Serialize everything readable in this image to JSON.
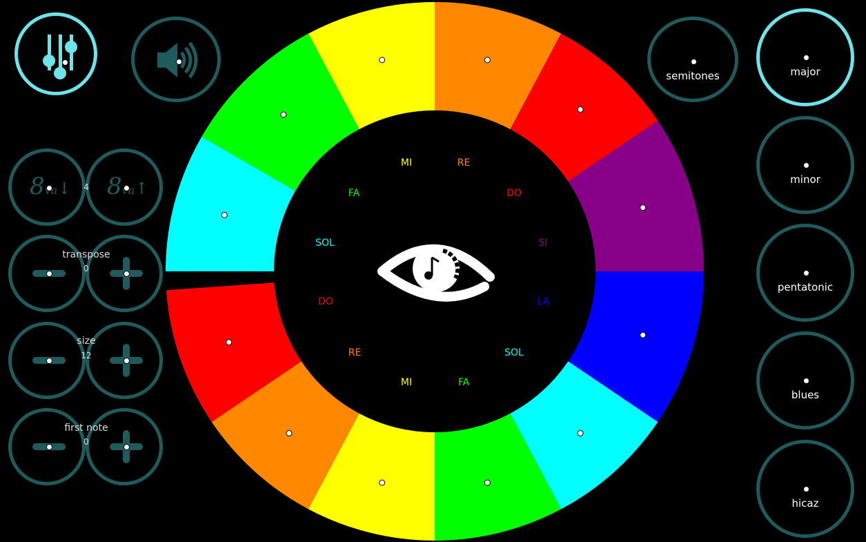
{
  "colors": {
    "accent": "#6fe3ea",
    "ring_inactive": "#1f5a5d",
    "background": "#000000"
  },
  "wheel": {
    "slices": [
      {
        "color": "#ff8800"
      },
      {
        "color": "#ff0000"
      },
      {
        "color": "#880088"
      },
      {
        "color": "#0000ff"
      },
      {
        "color": "#00ffff"
      },
      {
        "color": "#00ff00"
      },
      {
        "color": "#ffff00"
      },
      {
        "color": "#ff8800"
      },
      {
        "color": "#ff0000"
      },
      {
        "color": "#000000"
      },
      {
        "color": "#00ffff"
      },
      {
        "color": "#00ff00"
      },
      {
        "color": "#ffff00"
      }
    ],
    "center_icon": "eye-music-icon",
    "note_labels": [
      {
        "text": "MI",
        "color": "#ffff00"
      },
      {
        "text": "RE",
        "color": "#ff8800"
      },
      {
        "text": "DO",
        "color": "#ff0000"
      },
      {
        "text": "SI",
        "color": "#880088"
      },
      {
        "text": "LA",
        "color": "#0000ff"
      },
      {
        "text": "SOL",
        "color": "#00ffff"
      },
      {
        "text": "FA",
        "color": "#00ff00"
      },
      {
        "text": "MI",
        "color": "#ffff00"
      },
      {
        "text": "RE",
        "color": "#ff8800"
      },
      {
        "text": "DO",
        "color": "#ff0000"
      },
      {
        "text": "SOL",
        "color": "#00ffff"
      },
      {
        "text": "FA",
        "color": "#00ff00"
      }
    ]
  },
  "left_panel": {
    "mixer_icon": "sliders-icon",
    "sound_icon": "speaker-icon",
    "octave": {
      "down_icon": "8va-down-icon",
      "up_icon": "8va-up-icon",
      "value": "4"
    },
    "transpose": {
      "label": "transpose",
      "value": "0"
    },
    "size": {
      "label": "size",
      "value": "12"
    },
    "first_note": {
      "label": "first note",
      "value": "0"
    }
  },
  "right_panel": {
    "semitones": "semitones",
    "scales": [
      "major",
      "minor",
      "pentatonic",
      "blues",
      "hicaz"
    ],
    "selected_scale": "major"
  }
}
